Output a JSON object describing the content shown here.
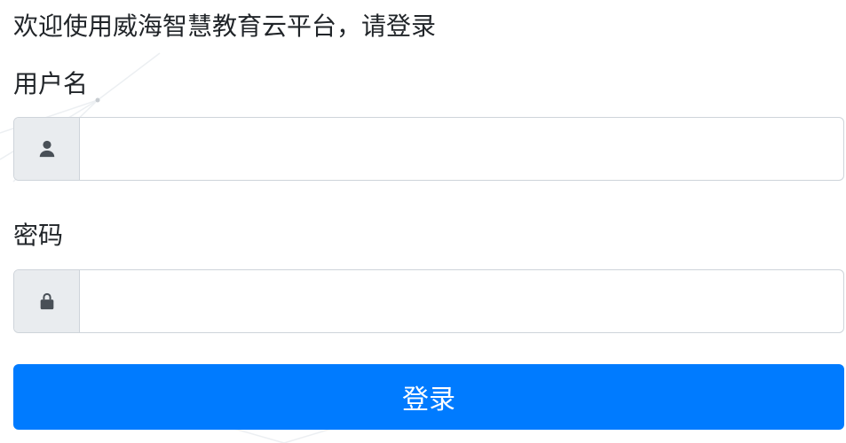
{
  "header": {
    "welcome_text": "欢迎使用威海智慧教育云平台，请登录"
  },
  "form": {
    "username": {
      "label": "用户名",
      "value": "",
      "icon": "user-icon"
    },
    "password": {
      "label": "密码",
      "value": "",
      "icon": "lock-icon"
    },
    "submit_label": "登录"
  },
  "colors": {
    "primary": "#007bff",
    "addon_bg": "#e9ecef",
    "border": "#ced4da",
    "icon": "#495057",
    "text": "#212529"
  }
}
